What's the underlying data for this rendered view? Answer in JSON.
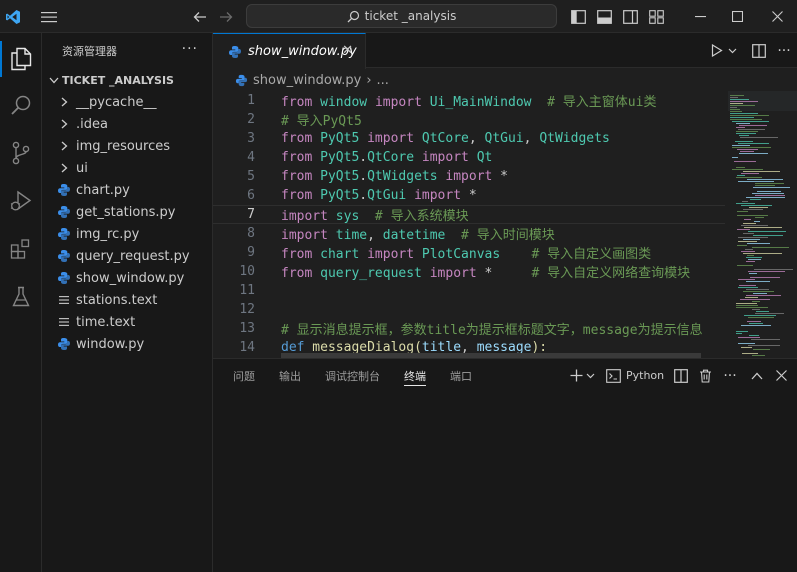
{
  "titlebar": {
    "search_text": "ticket _analysis"
  },
  "sidebar": {
    "title": "资源管理器",
    "more": "···",
    "root_label": "TICKET _ANALYSIS",
    "items": [
      {
        "label": "__pycache__",
        "type": "folder"
      },
      {
        "label": ".idea",
        "type": "folder"
      },
      {
        "label": "img_resources",
        "type": "folder"
      },
      {
        "label": "ui",
        "type": "folder"
      },
      {
        "label": "chart.py",
        "type": "py"
      },
      {
        "label": "get_stations.py",
        "type": "py"
      },
      {
        "label": "img_rc.py",
        "type": "py"
      },
      {
        "label": "query_request.py",
        "type": "py"
      },
      {
        "label": "show_window.py",
        "type": "py"
      },
      {
        "label": "stations.text",
        "type": "text"
      },
      {
        "label": "time.text",
        "type": "text"
      },
      {
        "label": "window.py",
        "type": "py"
      }
    ]
  },
  "editor": {
    "tab_label": "show_window.py",
    "breadcrumb_file": "show_window.py",
    "breadcrumb_more": "...",
    "current_line": 7,
    "lines": [
      {
        "n": "1"
      },
      {
        "n": "2"
      },
      {
        "n": "3"
      },
      {
        "n": "4"
      },
      {
        "n": "5"
      },
      {
        "n": "6"
      },
      {
        "n": "7"
      },
      {
        "n": "8"
      },
      {
        "n": "9"
      },
      {
        "n": "10"
      },
      {
        "n": "11"
      },
      {
        "n": "12"
      },
      {
        "n": "13"
      },
      {
        "n": "14"
      }
    ],
    "code": {
      "l1": {
        "a": "from",
        "b": " window ",
        "c": "import",
        "d": " Ui_MainWindow",
        "e": "  # 导入主窗体ui类"
      },
      "l2": {
        "a": "# 导入PyQt5"
      },
      "l3": {
        "a": "from",
        "b": " PyQt5 ",
        "c": "import",
        "d": " QtCore",
        "e": ", ",
        "f": "QtGui",
        "g": ", ",
        "h": "QtWidgets"
      },
      "l4": {
        "a": "from",
        "b": " PyQt5",
        "c": ".",
        "d": "QtCore",
        "e": " import",
        "f": " Qt"
      },
      "l5": {
        "a": "from",
        "b": " PyQt5",
        "c": ".",
        "d": "QtWidgets",
        "e": " import",
        "f": " *"
      },
      "l6": {
        "a": "from",
        "b": " PyQt5",
        "c": ".",
        "d": "QtGui",
        "e": " import",
        "f": " *"
      },
      "l7": {
        "a": "import",
        "b": " sys",
        "c": "  # 导入系统模块"
      },
      "l8": {
        "a": "import",
        "b": " time",
        "c": ", ",
        "d": "datetime",
        "e": "  # 导入时间模块"
      },
      "l9": {
        "a": "from",
        "b": " chart ",
        "c": "import",
        "d": " PlotCanvas",
        "e": "    # 导入自定义画图类"
      },
      "l10": {
        "a": "from",
        "b": " query_request ",
        "c": "import",
        "d": " *",
        "e": "     # 导入自定义网络查询模块"
      },
      "l13": {
        "a": "# 显示消息提示框，参数title为提示框标题文字，message为提示信息"
      },
      "l14": {
        "a": "def",
        "b": " messageDialog",
        "c": "(",
        "d": "title",
        "e": ", ",
        "f": "message",
        "g": "):"
      }
    }
  },
  "panel": {
    "tabs": [
      "问题",
      "输出",
      "调试控制台",
      "终端",
      "端口"
    ],
    "active_tab": "终端",
    "terminal_label": "Python"
  },
  "colors": {
    "accent": "#0078d4",
    "python_icon": "#3b8eea"
  }
}
